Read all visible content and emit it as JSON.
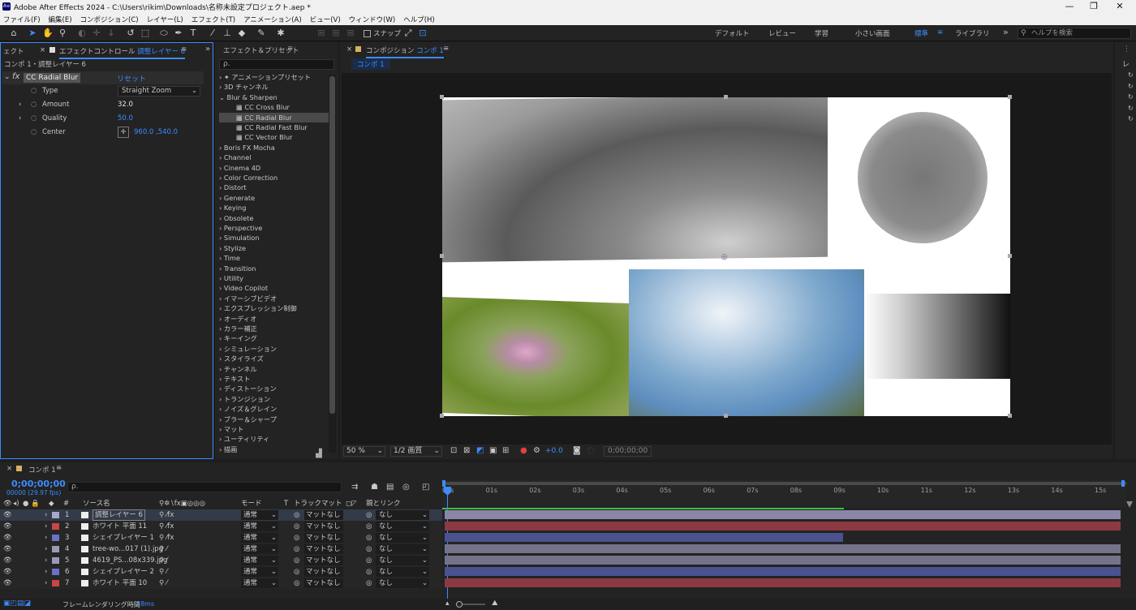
{
  "window": {
    "app_icon": "Ae",
    "title": "Adobe After Effects 2024 - C:\\Users\\rikim\\Downloads\\名称未設定プロジェクト.aep *",
    "minimize": "—",
    "maximize": "❐",
    "close": "✕"
  },
  "menu": [
    "ファイル(F)",
    "編集(E)",
    "コンポジション(C)",
    "レイヤー(L)",
    "エフェクト(T)",
    "アニメーション(A)",
    "ビュー(V)",
    "ウィンドウ(W)",
    "ヘルプ(H)"
  ],
  "toolbar": {
    "snap_label": "スナップ",
    "workspaces": [
      "デフォルト",
      "レビュー",
      "学習",
      "小さい画面",
      "標準",
      "ライブラリ"
    ],
    "active_workspace": "標準",
    "help_search": "ヘルプを検索"
  },
  "effect_controls": {
    "left_tab_clip": "ェクト",
    "tab_prefix": "エフェクトコントロール",
    "tab_layer": "調整レイヤー 6",
    "breadcrumb": "コンポ 1・調整レイヤー 6",
    "effect_name": "CC Radial Blur",
    "reset": "リセット",
    "params": [
      {
        "label": "Type",
        "value": "Straight Zoom"
      },
      {
        "label": "Amount",
        "value": "32.0"
      },
      {
        "label": "Quality",
        "value": "50.0"
      },
      {
        "label": "Center",
        "value": "960.0 ,540.0"
      }
    ]
  },
  "effects_presets": {
    "tab": "エフェクト＆プリセット",
    "search_placeholder": "ρ.",
    "items": [
      "✦ アニメーションプリセット",
      "3D チャンネル",
      "Blur & Sharpen",
      "CC Cross Blur",
      "CC Radial Blur",
      "CC Radial Fast Blur",
      "CC Vector Blur",
      "Boris FX Mocha",
      "Channel",
      "Cinema 4D",
      "Color Correction",
      "Distort",
      "Generate",
      "Keying",
      "Obsolete",
      "Perspective",
      "Simulation",
      "Stylize",
      "Time",
      "Transition",
      "Utility",
      "Video Copilot",
      "イマーシブビデオ",
      "エクスプレッション制御",
      "オーディオ",
      "カラー補正",
      "キーイング",
      "シミュレーション",
      "スタイライズ",
      "チャンネル",
      "テキスト",
      "ディストーション",
      "トランジション",
      "ノイズ＆グレイン",
      "ブラー＆シャープ",
      "マット",
      "ユーティリティ",
      "描画"
    ]
  },
  "composition": {
    "tab_prefix": "コンポジション",
    "tab_name": "コンポ 1",
    "sub_tab": "コンポ 1",
    "zoom": "50 %",
    "quality": "1/2 画質",
    "exposure": "+0.0",
    "timecode": "0;00;00;00"
  },
  "timeline": {
    "tab": "コンポ 1",
    "timecode": "0;00;00;00",
    "fps": "00000 (29.97 fps)",
    "search_placeholder": "ρ.",
    "headers": {
      "num": "#",
      "source": "ソース名",
      "mode": "モード",
      "t": "T",
      "trackmatte": "トラックマット",
      "parent": "親とリンク"
    },
    "ruler": [
      "00s",
      "01s",
      "02s",
      "03s",
      "04s",
      "05s",
      "06s",
      "07s",
      "08s",
      "09s",
      "10s",
      "11s",
      "12s",
      "13s",
      "14s",
      "15s"
    ],
    "layers": [
      {
        "num": "1",
        "name": "調整レイヤー 6",
        "color": "#a8a8c8",
        "mode": "通常",
        "matte": "マットなし",
        "parent": "なし",
        "bar_color": "#8a86a8",
        "end": 1.0
      },
      {
        "num": "2",
        "name": "ホワイト 平面 11",
        "color": "#c84646",
        "mode": "通常",
        "matte": "マットなし",
        "parent": "なし",
        "bar_color": "#8c3a42",
        "end": 1.0
      },
      {
        "num": "3",
        "name": "シェイプレイヤー 1",
        "color": "#6a72c8",
        "mode": "通常",
        "matte": "マットなし",
        "parent": "なし",
        "bar_color": "#4a5290",
        "end": 0.59
      },
      {
        "num": "4",
        "name": "tree-wo...017 (1).jpg",
        "color": "#9a9ab8",
        "mode": "通常",
        "matte": "マットなし",
        "parent": "なし",
        "bar_color": "#75738a",
        "end": 1.0
      },
      {
        "num": "5",
        "name": "4619_PS...08x339.jpg",
        "color": "#9a9ab8",
        "mode": "通常",
        "matte": "マットなし",
        "parent": "なし",
        "bar_color": "#75738a",
        "end": 1.0
      },
      {
        "num": "6",
        "name": "シェイプレイヤー 2",
        "color": "#6a72c8",
        "mode": "通常",
        "matte": "マットなし",
        "parent": "なし",
        "bar_color": "#4a5290",
        "end": 1.0
      },
      {
        "num": "7",
        "name": "ホワイト 平面 10",
        "color": "#c84646",
        "mode": "通常",
        "matte": "マットなし",
        "parent": "なし",
        "bar_color": "#8c3a42",
        "end": 1.0
      }
    ],
    "footer": "フレームレンダリング時間",
    "render_time": "18ms"
  }
}
